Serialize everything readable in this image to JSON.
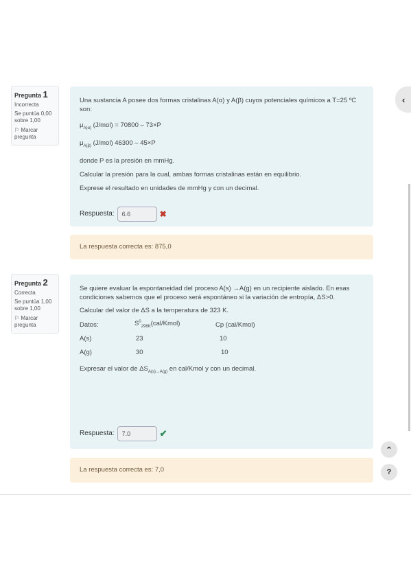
{
  "q1": {
    "label": "Pregunta",
    "number": "1",
    "state": "Incorrecta",
    "grade": "Se puntúa 0,00 sobre 1,00",
    "flag": "Marcar pregunta",
    "intro": "Una sustancia A posee dos formas cristalinas A(α) y A(β) cuyos potenciales químicos a T=25 ºC son:",
    "mu_alpha_sym": "μ",
    "mu_alpha_sub": "A(α)",
    "mu_alpha_expr": "(J/mol) = 70800 – 73×P",
    "mu_beta_sym": "μ",
    "mu_beta_sub": "A(β)",
    "mu_beta_expr": "(J/mol)  46300 – 45×P",
    "where": "donde P es la presión en mmHg.",
    "task": "Calcular la presión para la cual, ambas formas cristalinas están en equilibrio.",
    "express": "Exprese el resultado en unidades de mmHg y con un decimal.",
    "answer_label": "Respuesta:",
    "answer_value": "6.6",
    "feedback": "La respuesta correcta es: 875,0"
  },
  "q2": {
    "label": "Pregunta",
    "number": "2",
    "state": "Correcta",
    "grade": "Se puntúa 1,00 sobre 1,00",
    "flag": "Marcar pregunta",
    "intro": "Se quiere evaluar la espontaneidad del proceso A(s) →A(g) en un recipiente aislado. En esas condiciones sabemos que el proceso será espontáneo si la variación de entropía,  ΔS>0.",
    "calc": "Calcular del valor de ΔS a la temperatura de 323 K.",
    "table": {
      "head_datos": "Datos:",
      "head_s_main": "S",
      "head_s_sup": "0",
      "head_s_sub": "298K",
      "head_s_unit": "(cal/Kmol)",
      "head_cp": "Cp (cal/Kmol)",
      "rows": [
        {
          "species": "A(s)",
          "s": "23",
          "cp": "10"
        },
        {
          "species": "A(g)",
          "s": "30",
          "cp": "10"
        }
      ]
    },
    "express_pre": "Expresar el valor de ΔS",
    "express_sub": "A(s)→A(g)",
    "express_post": " en cal/Kmol y con un decimal.",
    "answer_label": "Respuesta:",
    "answer_value": "7.0",
    "feedback": "La respuesta correcta es: 7,0"
  },
  "nav": {
    "drawer_icon": "chevron-left-icon",
    "top_icon": "chevron-up-icon",
    "help_icon": "question-icon",
    "help_label": "?"
  },
  "colors": {
    "question_bg": "#e7f3f5",
    "feedback_bg": "#fcefdc",
    "incorrect": "#c0392b",
    "correct": "#2e8b57"
  }
}
